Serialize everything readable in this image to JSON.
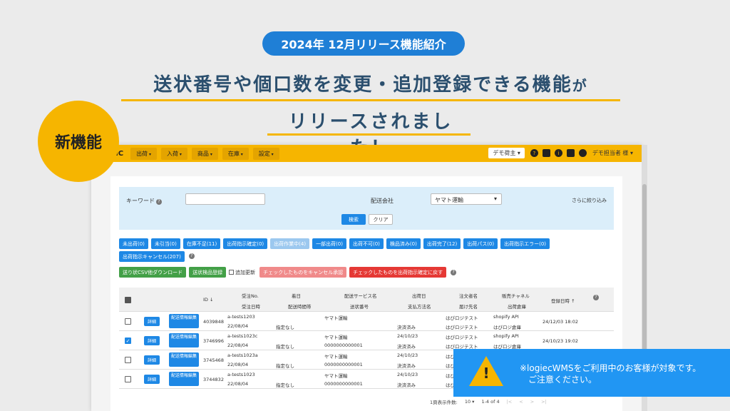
{
  "announcement": "2024年 12月リリース機能紹介",
  "headline_main": "送状番号や個口数を変更・追加登録できる機能",
  "headline_suffix": "が",
  "headline_line2": "リリースされました！",
  "badge": "新機能",
  "nav": {
    "logo": "IC",
    "items": [
      "出荷",
      "入荷",
      "商品",
      "在庫",
      "設定"
    ],
    "shipper": "デモ荷主",
    "user": "デモ担当者 様"
  },
  "search": {
    "keyword_label": "キーワード",
    "carrier_label": "配送会社",
    "carrier_value": "ヤマト運輸",
    "more": "さらに絞り込み",
    "search_btn": "検索",
    "clear_btn": "クリア"
  },
  "filters_row1": [
    "未出荷(0)",
    "未引当(0)",
    "在庫不足(11)",
    "出荷指示確定(0)",
    "出荷作業中(4)",
    "一部出荷(0)",
    "出荷不可(0)",
    "検品済み(0)",
    "出荷完了(12)",
    "出荷パス(0)",
    "出荷指示エラー(0)"
  ],
  "filters_row2": [
    "出荷指示キャンセル(207)"
  ],
  "actions": {
    "csv": "送り状CSV他ダウンロード",
    "inspect": "送状検品登録",
    "append": "追加更新",
    "cancel": "チェックしたものをキャンセル承認",
    "revert": "チェックしたものを出荷指示確定に戻す"
  },
  "table_headers": {
    "id": "ID ↓",
    "order_no": "受注No.",
    "order_date": "受注日時",
    "arrival": "着日",
    "time_slot": "配送時間帯",
    "service": "配送サービス名",
    "tracking": "送状番号",
    "ship_date": "出荷日",
    "payment": "支払方法名",
    "customer": "注文者名",
    "destination": "届け先名",
    "channel": "販売チャネル",
    "warehouse": "出荷倉庫",
    "registered": "登録日時 ↑"
  },
  "rows": [
    {
      "checked": false,
      "id": "4039848",
      "order_no": "a-tests1203",
      "order_date": "22/08/04",
      "time_slot": "指定なし",
      "service": "ヤマト運輸",
      "tracking": "",
      "ship_date": "",
      "payment": "決済済み",
      "customer": "はぴロジテスト",
      "destination": "はぴロジテスト",
      "channel": "shopify API",
      "warehouse": "はぴロジ倉庫",
      "registered": "24/12/03 18:02"
    },
    {
      "checked": true,
      "id": "3746996",
      "order_no": "a-tests1023c",
      "order_date": "22/08/04",
      "time_slot": "指定なし",
      "service": "ヤマト運輸",
      "tracking": "0000000000001",
      "ship_date": "24/10/23",
      "payment": "決済済み",
      "customer": "はぴロジテスト",
      "destination": "はぴロジテスト",
      "channel": "shopify API",
      "warehouse": "はぴロジ倉庫",
      "registered": "24/10/23 19:02"
    },
    {
      "checked": false,
      "id": "3745468",
      "order_no": "a-tests1023a",
      "order_date": "22/08/04",
      "time_slot": "指定なし",
      "service": "ヤマト運輸",
      "tracking": "0000000000001",
      "ship_date": "24/10/23",
      "payment": "決済済み",
      "customer": "はぴ",
      "destination": "はぴ",
      "channel": "",
      "warehouse": "",
      "registered": ""
    },
    {
      "checked": false,
      "id": "3744832",
      "order_no": "a-tests1023",
      "order_date": "22/08/04",
      "time_slot": "指定なし",
      "service": "ヤマト運輸",
      "tracking": "0000000000001",
      "ship_date": "24/10/23",
      "payment": "決済済み",
      "customer": "はぴ",
      "destination": "はぴ",
      "channel": "",
      "warehouse": "",
      "registered": ""
    }
  ],
  "row_buttons": {
    "detail": "詳細",
    "edit": "配送情報編集"
  },
  "pagination": {
    "per_page_label": "1頁表示件数:",
    "per_page": "10 ▾",
    "range": "1-4 of 4"
  },
  "notice": {
    "line1": "※logiecWMSをご利用中のお客様が対象です。",
    "line2": "ご注意ください。"
  }
}
